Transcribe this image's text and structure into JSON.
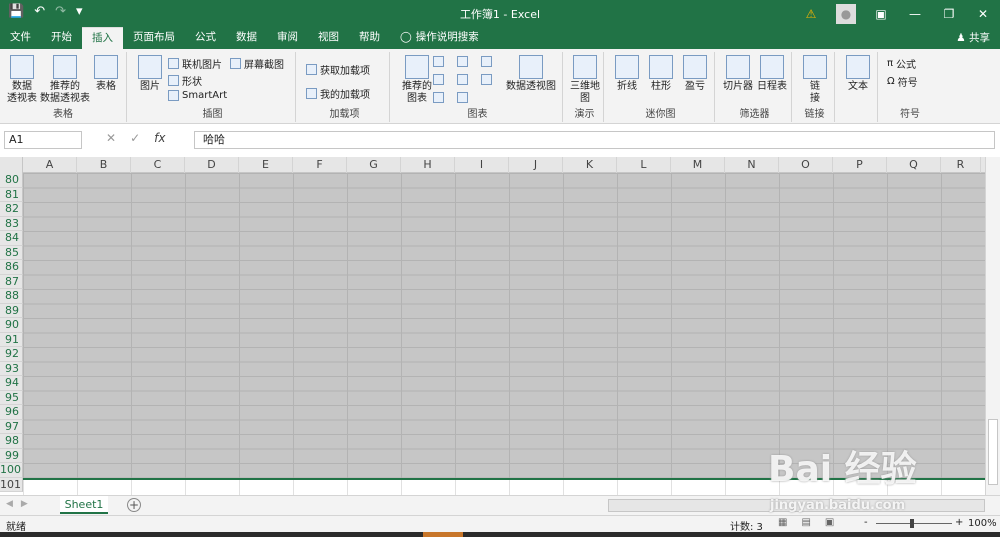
{
  "window": {
    "title": "工作簿1  -  Excel",
    "qat": [
      "save-icon",
      "undo-icon",
      "redo-icon",
      "customize-icon"
    ],
    "controls": [
      "warning-icon",
      "avatar",
      "ribbon-display-icon",
      "minimize-icon",
      "restore-icon",
      "close-icon"
    ]
  },
  "tabs": [
    {
      "label": "文件"
    },
    {
      "label": "开始"
    },
    {
      "label": "插入",
      "active": true
    },
    {
      "label": "页面布局"
    },
    {
      "label": "公式"
    },
    {
      "label": "数据"
    },
    {
      "label": "审阅"
    },
    {
      "label": "视图"
    },
    {
      "label": "帮助"
    }
  ],
  "tell_me": "操作说明搜索",
  "share": "共享",
  "ribbon": {
    "tables": {
      "pivot": "数据\n透视表",
      "recommended_pivot": "推荐的\n数据透视表",
      "table": "表格",
      "label": "表格"
    },
    "illustrations": {
      "picture": "图片",
      "online_picture": "联机图片",
      "shapes": "形状",
      "smartart": "SmartArt",
      "screenshot": "屏幕截图",
      "label": "插图"
    },
    "addins": {
      "get": "获取加载项",
      "my": "我的加载项",
      "label": "加载项"
    },
    "charts": {
      "recommended": "推荐的\n图表",
      "pivot_chart": "数据透视图",
      "label": "图表"
    },
    "tours": {
      "map3d": "三维地\n图",
      "label": "演示"
    },
    "sparklines": {
      "line": "折线",
      "column": "柱形",
      "winloss": "盈亏",
      "label": "迷你图"
    },
    "filters": {
      "slicer": "切片器",
      "timeline": "日程表",
      "label": "筛选器"
    },
    "links": {
      "link": "链\n接",
      "label": "链接"
    },
    "text": {
      "text": "文本",
      "label": ""
    },
    "symbols": {
      "equation": "公式",
      "symbol": "符号",
      "label": "符号"
    }
  },
  "formula_bar": {
    "name_box": "A1",
    "fx": "fx",
    "value": "哈哈"
  },
  "columns": [
    "A",
    "B",
    "C",
    "D",
    "E",
    "F",
    "G",
    "H",
    "I",
    "J",
    "K",
    "L",
    "M",
    "N",
    "O",
    "P",
    "Q",
    "R"
  ],
  "rows": [
    "80",
    "81",
    "82",
    "83",
    "84",
    "85",
    "86",
    "87",
    "88",
    "89",
    "90",
    "91",
    "92",
    "93",
    "94",
    "95",
    "96",
    "97",
    "98",
    "99",
    "100",
    "101"
  ],
  "sheets": [
    {
      "label": "Sheet1",
      "active": true
    }
  ],
  "status": {
    "ready": "就绪",
    "count": "计数: 3",
    "zoom": "100%",
    "zoom_minus": "-",
    "zoom_plus": "+"
  },
  "watermark": {
    "text": "Bai 经验",
    "url": "jingyan.baidu.com"
  }
}
